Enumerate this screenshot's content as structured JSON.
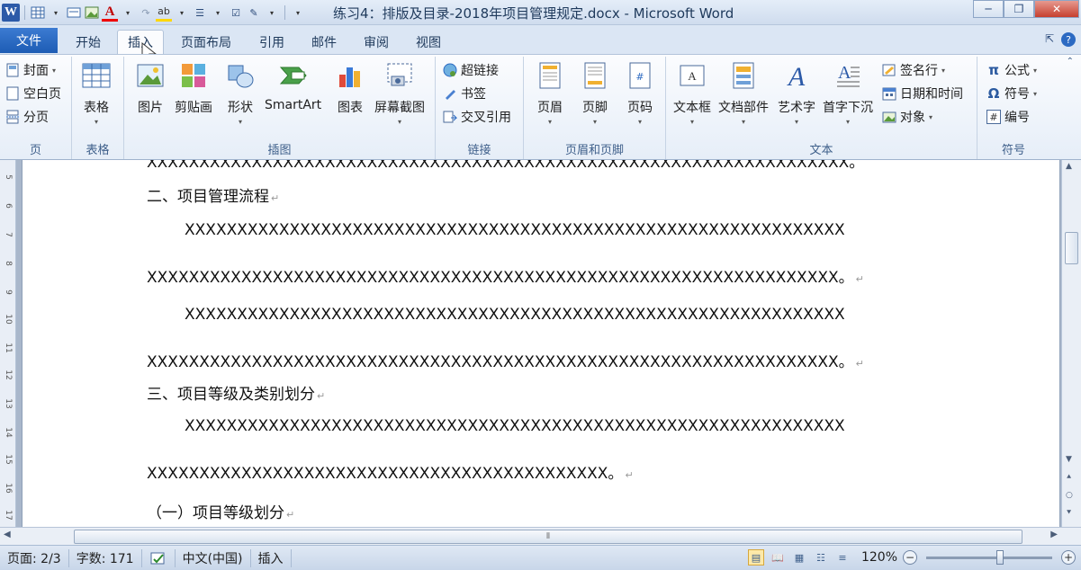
{
  "window": {
    "title": "练习4：排版及目录-2018年项目管理规定.docx - Microsoft Word"
  },
  "quick_access": {
    "app_icon": "word-icon",
    "font_color_glyph": "A",
    "highlight_glyph": "ab"
  },
  "tabs": [
    {
      "label": "文件"
    },
    {
      "label": "开始"
    },
    {
      "label": "插入",
      "active": true
    },
    {
      "label": "页面布局"
    },
    {
      "label": "引用"
    },
    {
      "label": "邮件"
    },
    {
      "label": "审阅"
    },
    {
      "label": "视图"
    }
  ],
  "ribbon": {
    "pages": {
      "label": "页",
      "items": [
        {
          "label": "封面",
          "icon": "cover-page-icon"
        },
        {
          "label": "空白页",
          "icon": "blank-page-icon"
        },
        {
          "label": "分页",
          "icon": "page-break-icon"
        }
      ]
    },
    "tables": {
      "label": "表格",
      "button": "表格"
    },
    "illustrations": {
      "label": "插图",
      "buttons": [
        {
          "label": "图片",
          "icon": "picture-icon"
        },
        {
          "label": "剪贴画",
          "icon": "clip-art-icon"
        },
        {
          "label": "形状",
          "icon": "shapes-icon"
        },
        {
          "label": "SmartArt",
          "icon": "smartart-icon"
        },
        {
          "label": "图表",
          "icon": "chart-icon"
        },
        {
          "label": "屏幕截图",
          "icon": "screenshot-icon"
        }
      ]
    },
    "links": {
      "label": "链接",
      "items": [
        {
          "label": "超链接",
          "icon": "hyperlink-icon"
        },
        {
          "label": "书签",
          "icon": "bookmark-icon"
        },
        {
          "label": "交叉引用",
          "icon": "cross-reference-icon"
        }
      ]
    },
    "header_footer": {
      "label": "页眉和页脚",
      "buttons": [
        {
          "label": "页眉",
          "icon": "header-icon"
        },
        {
          "label": "页脚",
          "icon": "footer-icon"
        },
        {
          "label": "页码",
          "icon": "page-number-icon"
        }
      ]
    },
    "text": {
      "label": "文本",
      "buttons": [
        {
          "label": "文本框",
          "icon": "text-box-icon"
        },
        {
          "label": "文档部件",
          "icon": "quick-parts-icon"
        },
        {
          "label": "艺术字",
          "icon": "wordart-icon"
        },
        {
          "label": "首字下沉",
          "icon": "drop-cap-icon"
        }
      ],
      "items": [
        {
          "label": "签名行",
          "icon": "signature-line-icon"
        },
        {
          "label": "日期和时间",
          "icon": "date-time-icon"
        },
        {
          "label": "对象",
          "icon": "object-icon"
        }
      ]
    },
    "symbols": {
      "label": "符号",
      "items": [
        {
          "label": "公式",
          "icon": "equation-icon",
          "glyph": "π"
        },
        {
          "label": "符号",
          "icon": "symbol-icon",
          "glyph": "Ω"
        },
        {
          "label": "编号",
          "icon": "number-icon",
          "glyph": "#"
        }
      ]
    }
  },
  "document": {
    "lines": [
      {
        "text": "XXXXXXXXXXXXXXXXXXXXXXXXXXXXXXXXXXXXXXXXXXXXXXXXXXXXXXXXXXXXXXXXXXX。",
        "type": "partial"
      },
      {
        "text": "二、项目管理流程",
        "type": "heading"
      },
      {
        "text": "XXXXXXXXXXXXXXXXXXXXXXXXXXXXXXXXXXXXXXXXXXXXXXXXXXXXXXXXXXXXXXX",
        "type": "indent"
      },
      {
        "text": "XXXXXXXXXXXXXXXXXXXXXXXXXXXXXXXXXXXXXXXXXXXXXXXXXXXXXXXXXXXXXXXXXX。",
        "type": "body"
      },
      {
        "text": "XXXXXXXXXXXXXXXXXXXXXXXXXXXXXXXXXXXXXXXXXXXXXXXXXXXXXXXXXXXXXXX",
        "type": "indent"
      },
      {
        "text": "XXXXXXXXXXXXXXXXXXXXXXXXXXXXXXXXXXXXXXXXXXXXXXXXXXXXXXXXXXXXXXXXXX。",
        "type": "body"
      },
      {
        "text": "三、项目等级及类别划分",
        "type": "heading"
      },
      {
        "text": "XXXXXXXXXXXXXXXXXXXXXXXXXXXXXXXXXXXXXXXXXXXXXXXXXXXXXXXXXXXXXXX",
        "type": "indent"
      },
      {
        "text": "XXXXXXXXXXXXXXXXXXXXXXXXXXXXXXXXXXXXXXXXXXXX。",
        "type": "body"
      },
      {
        "text": "（一）项目等级划分",
        "type": "subheading"
      }
    ],
    "ruler_numbers": [
      "5",
      "6",
      "7",
      "8",
      "9",
      "10",
      "11",
      "12",
      "13",
      "14",
      "15",
      "16",
      "17"
    ]
  },
  "status": {
    "page": "页面: 2/3",
    "words": "字数: 171",
    "language": "中文(中国)",
    "mode": "插入",
    "zoom": "120%"
  }
}
